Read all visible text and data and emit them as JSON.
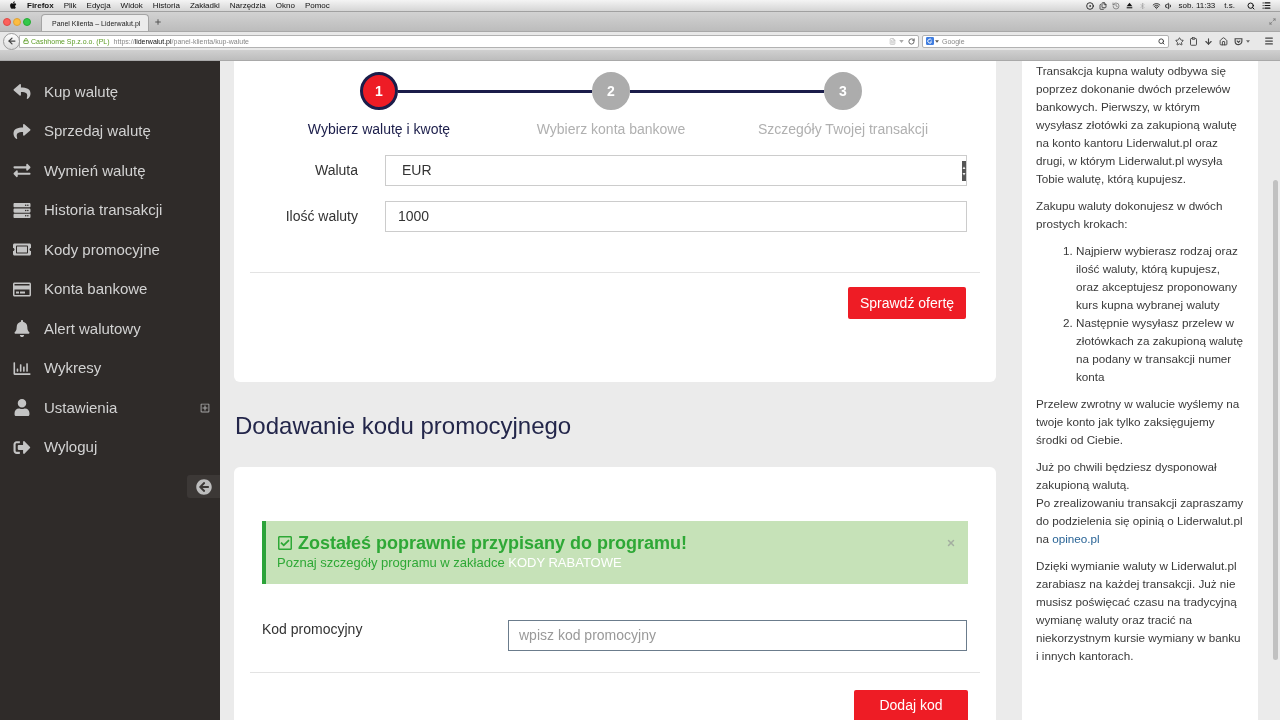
{
  "menu_bar": {
    "app": "Firefox",
    "items": [
      "Plik",
      "Edycja",
      "Widok",
      "Historia",
      "Zakładki",
      "Narzędzia",
      "Okno",
      "Pomoc"
    ],
    "clock": "sob. 11:33",
    "user": "t.s."
  },
  "browser": {
    "tabs": [
      {
        "title": "Panel Klienta – Liderwalut.pl",
        "selected": true
      }
    ],
    "url_bar": {
      "identity": "Cashhome Sp.z.o.o. (PL)",
      "scheme": "https://",
      "domain": "liderwalut.pl",
      "path": "/panel-klienta/kup-walute"
    },
    "search": {
      "placeholder": "Google"
    }
  },
  "sidebar": {
    "items": [
      {
        "kind": "link",
        "label": "Kup walutę"
      },
      {
        "kind": "link",
        "label": "Sprzedaj walutę"
      },
      {
        "kind": "link",
        "label": "Wymień walutę"
      },
      {
        "kind": "link",
        "label": "Historia transakcji"
      },
      {
        "kind": "link",
        "label": "Kody promocyjne"
      },
      {
        "kind": "link",
        "label": "Konta bankowe"
      },
      {
        "kind": "link",
        "label": "Alert walutowy"
      },
      {
        "kind": "link",
        "label": "Wykresy"
      },
      {
        "kind": "group",
        "label": "Ustawienia",
        "expanded": false
      },
      {
        "kind": "link",
        "label": "Wyloguj"
      }
    ]
  },
  "stepper": {
    "steps": [
      {
        "number": "1",
        "label": "Wybierz walutę i kwotę",
        "selected": true
      },
      {
        "number": "2",
        "label": "Wybierz konta bankowe",
        "selected": false
      },
      {
        "number": "3",
        "label": "Szczegóły Twojej transakcji",
        "selected": false
      }
    ]
  },
  "offer_form": {
    "fields": [
      {
        "kind": "select",
        "label": "Waluta",
        "value": "EUR"
      },
      {
        "kind": "input",
        "label": "Ilość waluty",
        "value": "1000"
      }
    ],
    "submit": "Sprawdź ofertę"
  },
  "promo_section": {
    "heading": "Dodawanie kodu promocyjnego",
    "alert": {
      "title": "Zostałeś poprawnie przypisany do programu!",
      "text": "Poznaj szczegóły programu w zakładce",
      "link": "KODY RABATOWE"
    },
    "field": {
      "label": "Kod promocyjny",
      "placeholder": "wpisz kod promocyjny",
      "focused": true
    },
    "submit": "Dodaj kod"
  },
  "info_panel": {
    "blocks": [
      {
        "kind": "paragraph",
        "lines": [
          "Transakcja kupna waluty odbywa się poprzez dokonanie dwóch przelewów bankowych. Pierwszy, w którym wysyłasz złotówki za zakupioną walutę na konto kantoru Liderwalut.pl oraz drugi, w którym Liderwalut.pl wysyła Tobie walutę, którą kupujesz."
        ]
      },
      {
        "kind": "paragraph",
        "lines": [
          "Zakupu waluty dokonujesz w dwóch prostych krokach:"
        ]
      },
      {
        "kind": "list",
        "items": [
          {
            "number": "1.",
            "text": "Najpierw wybierasz rodzaj oraz ilość waluty, którą kupujesz, oraz akceptujesz proponowany kurs kupna wybranej waluty"
          },
          {
            "number": "2.",
            "text": "Następnie wysyłasz przelew w złotówkach za zakupioną walutę na podany w transakcji numer konta"
          }
        ]
      },
      {
        "kind": "paragraph",
        "lines": [
          "Przelew zwrotny w walucie wyślemy na twoje konto jak tylko zaksięgujemy środki od Ciebie."
        ]
      },
      {
        "kind": "paragraph",
        "lines": [
          "Już po chwili będziesz dysponował zakupioną walutą.",
          "Po zrealizowaniu transakcji zapraszamy do podzielenia się opinią o Liderwalut.pl na"
        ],
        "link": "opineo.pl"
      },
      {
        "kind": "paragraph",
        "lines": [
          "Dzięki wymianie waluty w Liderwalut.pl zarabiasz na każdej transakcji. Już nie musisz poświęcać czasu na tradycyjną wymianę waluty oraz tracić na niekorzystnym kursie wymiany w banku i innych kantorach."
        ]
      }
    ]
  }
}
